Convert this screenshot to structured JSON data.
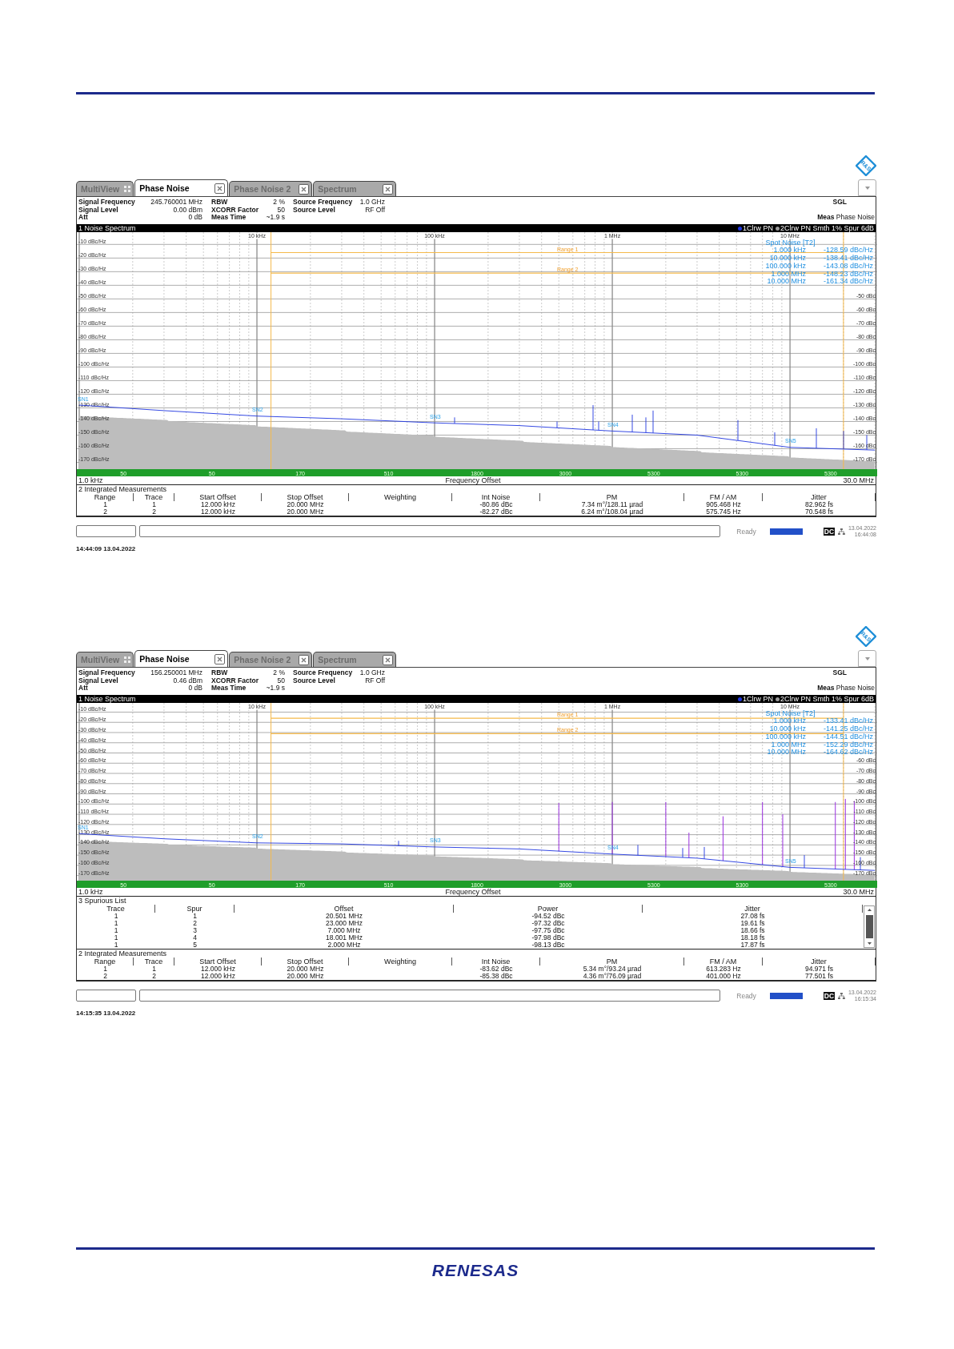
{
  "screens": [
    {
      "logo": "R&S",
      "tabs": [
        {
          "label": "MultiView",
          "selected": false,
          "kind": "multiview"
        },
        {
          "label": "Phase Noise",
          "selected": true,
          "kind": "measurement"
        },
        {
          "label": "Phase Noise 2",
          "selected": false,
          "kind": "measurement"
        },
        {
          "label": "Spectrum",
          "selected": false,
          "kind": "measurement"
        }
      ],
      "info_rows": [
        [
          {
            "label": "Signal Frequency",
            "value": "245.760001 MHz"
          },
          {
            "label": "RBW",
            "value": "2 %"
          },
          {
            "label": "Source Frequency",
            "value": "1.0 GHz"
          }
        ],
        [
          {
            "label": "Signal Level",
            "value": "0.00 dBm"
          },
          {
            "label": "XCORR Factor",
            "value": "50"
          },
          {
            "label": "Source Level",
            "value": "RF Off"
          }
        ],
        [
          {
            "label": "Att",
            "value": "0 dB"
          },
          {
            "label": "Meas Time",
            "value": "~1.9 s"
          }
        ]
      ],
      "sweep_mode": "SGL",
      "meas": "**Meas** Phase Noise",
      "pane_title": "1 Noise Spectrum",
      "other_traces": [
        {
          "label": "2Clrw PN Smth 1% Spur 6dB",
          "color": "#9a9a9a"
        }
      ],
      "x_start": "1.0 kHz",
      "x_stop": "30.0 MHz",
      "chart_data": {
        "type": "line",
        "xlabel": "Frequency Offset",
        "ylim": [
          -175,
          -1
        ],
        "grid": true,
        "categories": [
          null,
          null,
          "10 kHz",
          null,
          "100 kHz",
          null,
          "1 MHz",
          null,
          "10 MHz",
          null
        ],
        "series": [
          {
            "name": "1Clrw PN",
            "color": "#1f35e0",
            "values": [
              -128,
              -132,
              -136,
              -138,
              -141,
              -143,
              -147,
              -150,
              -159,
              -161
            ]
          }
        ],
        "yticks": [
          {
            "value": -10,
            "label": "-10 dBc/Hz"
          },
          {
            "value": -20,
            "label": "-20 dBc/Hz"
          },
          {
            "value": -30,
            "label": "-30 dBc/Hz"
          },
          {
            "value": -40,
            "label": "-40 dBc/Hz"
          },
          {
            "value": -50,
            "label": "-50 dBc/Hz"
          },
          {
            "value": -60,
            "label": "-60 dBc/Hz"
          },
          {
            "value": -70,
            "label": "-70 dBc/Hz"
          },
          {
            "value": -80,
            "label": "-80 dBc/Hz"
          },
          {
            "value": -90,
            "label": "-90 dBc/Hz"
          },
          {
            "value": -100,
            "label": "-100 dBc/Hz"
          },
          {
            "value": -110,
            "label": "-110 dBc/Hz"
          },
          {
            "value": -120,
            "label": "-120 dBc/Hz"
          },
          {
            "value": -130,
            "label": "-130 dBc/Hz"
          },
          {
            "value": -140,
            "label": "-140 dBc/Hz"
          },
          {
            "value": -150,
            "label": "-150 dBc/Hz"
          },
          {
            "value": -160,
            "label": "-160 dBc/Hz"
          },
          {
            "value": -170,
            "label": "-170 dBc/Hz"
          }
        ]
      },
      "ranges": [
        "Range 1",
        "Range 2"
      ],
      "markers": [
        "SN1",
        "SN2",
        "SN3",
        "SN4",
        "SN5"
      ],
      "right_tick_labels": [
        "-50 dBc",
        "-60 dBc",
        "-70 dBc",
        "-80 dBc",
        "-90 dBc",
        "-100 dBc",
        "-110 dBc",
        "-120 dBc",
        "-130 dBc",
        "-140 dBc",
        "-150 dBc",
        "-160 dBc",
        "-170 dBc"
      ],
      "spot_noise": {
        "title": "Spot Noise [T2]",
        "rows": [
          {
            "offset": "1.000 kHz",
            "value": "-128.59 dBc/Hz"
          },
          {
            "offset": "10.000 kHz",
            "value": "-138.41 dBc/Hz"
          },
          {
            "offset": "100.000 kHz",
            "value": "-143.08 dBc/Hz"
          },
          {
            "offset": "1.000 MHz",
            "value": "-148.23 dBc/Hz"
          },
          {
            "offset": "10.000 MHz",
            "value": "-161.34 dBc/Hz"
          }
        ]
      },
      "rbw_labels": [
        "50",
        "50",
        "170",
        "510",
        "1800",
        "3000",
        "5300",
        "5300",
        "5300"
      ],
      "integrated": {
        "title": "2 Integrated Measurements",
        "columns": [
          "Range",
          "Trace",
          "Start Offset",
          "Stop Offset",
          "Weighting",
          "Int Noise",
          "PM",
          "FM / AM",
          "Jitter"
        ],
        "rows": [
          [
            "1",
            "1",
            "12.000 kHz",
            "20.000 MHz",
            "",
            "-80.86 dBc",
            "7.34 m°/128.11 µrad",
            "905.468 Hz",
            "82.962 fs"
          ],
          [
            "2",
            "2",
            "12.000 kHz",
            "20.000 MHz",
            "",
            "-82.27 dBc",
            "6.24 m°/108.04 µrad",
            "575.745 Hz",
            "70.548 fs"
          ]
        ]
      },
      "status": {
        "text": "Ready",
        "badge": "DC",
        "date": "13.04.2022",
        "time": "16:44:08"
      },
      "timestamp": "14:44:09 13.04.2022"
    },
    {
      "logo": "R&S",
      "tabs": [
        {
          "label": "MultiView",
          "selected": false,
          "kind": "multiview"
        },
        {
          "label": "Phase Noise",
          "selected": true,
          "kind": "measurement"
        },
        {
          "label": "Phase Noise 2",
          "selected": false,
          "kind": "measurement"
        },
        {
          "label": "Spectrum",
          "selected": false,
          "kind": "measurement"
        }
      ],
      "info_rows": [
        [
          {
            "label": "Signal Frequency",
            "value": "156.250001 MHz"
          },
          {
            "label": "RBW",
            "value": "2 %"
          },
          {
            "label": "Source Frequency",
            "value": "1.0 GHz"
          }
        ],
        [
          {
            "label": "Signal Level",
            "value": "0.46 dBm"
          },
          {
            "label": "XCORR Factor",
            "value": "50"
          },
          {
            "label": "Source Level",
            "value": "RF Off"
          }
        ],
        [
          {
            "label": "Att",
            "value": "0 dB"
          },
          {
            "label": "Meas Time",
            "value": "~1.9 s"
          }
        ]
      ],
      "sweep_mode": "SGL",
      "meas": "**Meas** Phase Noise",
      "pane_title": "1 Noise Spectrum",
      "other_traces": [
        {
          "label": "2Clrw PN Smth 1% Spur 6dB",
          "color": "#9a9a9a"
        }
      ],
      "x_start": "1.0 kHz",
      "x_stop": "30.0 MHz",
      "chart_data": {
        "type": "line",
        "xlabel": "Frequency Offset",
        "ylim": [
          -175,
          -1
        ],
        "grid": true,
        "categories": [
          null,
          null,
          "10 kHz",
          null,
          "100 kHz",
          null,
          "1 MHz",
          null,
          "10 MHz",
          null
        ],
        "series": [
          {
            "name": "1Clrw PN",
            "color": "#1f35e0",
            "values": [
              -129,
              -134,
              -138,
              -139,
              -142,
              -144,
              -149,
              -153,
              -162,
              -165
            ]
          }
        ],
        "yticks": [
          {
            "value": -10,
            "label": "-10 dBc/Hz"
          },
          {
            "value": -20,
            "label": "-20 dBc/Hz"
          },
          {
            "value": -30,
            "label": "-30 dBc/Hz"
          },
          {
            "value": -40,
            "label": "-40 dBc/Hz"
          },
          {
            "value": -50,
            "label": "-50 dBc/Hz"
          },
          {
            "value": -60,
            "label": "-60 dBc/Hz"
          },
          {
            "value": -70,
            "label": "-70 dBc/Hz"
          },
          {
            "value": -80,
            "label": "-80 dBc/Hz"
          },
          {
            "value": -90,
            "label": "-90 dBc/Hz"
          },
          {
            "value": -100,
            "label": "-100 dBc/Hz"
          },
          {
            "value": -110,
            "label": "-110 dBc/Hz"
          },
          {
            "value": -120,
            "label": "-120 dBc/Hz"
          },
          {
            "value": -130,
            "label": "-130 dBc/Hz"
          },
          {
            "value": -140,
            "label": "-140 dBc/Hz"
          },
          {
            "value": -150,
            "label": "-150 dBc/Hz"
          },
          {
            "value": -160,
            "label": "-160 dBc/Hz"
          },
          {
            "value": -170,
            "label": "-170 dBc/Hz"
          }
        ]
      },
      "ranges": [
        "Range 1",
        "Range 2"
      ],
      "markers": [
        "SN1",
        "SN2",
        "SN3",
        "SN4",
        "SN5"
      ],
      "right_tick_labels": [
        "-60 dBc",
        "-70 dBc",
        "-80 dBc",
        "-90 dBc",
        "-100 dBc",
        "-110 dBc",
        "-120 dBc",
        "-130 dBc",
        "-140 dBc",
        "-150 dBc",
        "-160 dBc",
        "-170 dBc"
      ],
      "spot_noise": {
        "title": "Spot Noise [T2]",
        "rows": [
          {
            "offset": "1.000 kHz",
            "value": "-133.41 dBc/Hz"
          },
          {
            "offset": "10.000 kHz",
            "value": "-141.25 dBc/Hz"
          },
          {
            "offset": "100.000 kHz",
            "value": "-144.51 dBc/Hz"
          },
          {
            "offset": "1.000 MHz",
            "value": "-152.29 dBc/Hz"
          },
          {
            "offset": "10.000 MHz",
            "value": "-164.62 dBc/Hz"
          }
        ]
      },
      "rbw_labels": [
        "50",
        "50",
        "170",
        "510",
        "1800",
        "3000",
        "5300",
        "5300",
        "5300"
      ],
      "spurious_list": {
        "title": "3 Spurious List",
        "columns": [
          "Trace",
          "Spur",
          "Offset",
          "Power",
          "Jitter"
        ],
        "rows": [
          [
            "1",
            "1",
            "20.501 MHz",
            "-94.52 dBc",
            "27.08 fs"
          ],
          [
            "1",
            "2",
            "23.000 MHz",
            "-97.32 dBc",
            "19.61 fs"
          ],
          [
            "1",
            "3",
            "7.000 MHz",
            "-97.75 dBc",
            "18.66 fs"
          ],
          [
            "1",
            "4",
            "18.001 MHz",
            "-97.98 dBc",
            "18.18 fs"
          ],
          [
            "1",
            "5",
            "2.000 MHz",
            "-98.13 dBc",
            "17.87 fs"
          ]
        ]
      },
      "integrated": {
        "title": "2 Integrated Measurements",
        "columns": [
          "Range",
          "Trace",
          "Start Offset",
          "Stop Offset",
          "Weighting",
          "Int Noise",
          "PM",
          "FM / AM",
          "Jitter"
        ],
        "rows": [
          [
            "1",
            "1",
            "12.000 kHz",
            "20.000 MHz",
            "",
            "-83.62 dBc",
            "5.34 m°/93.24 µrad",
            "613.283 Hz",
            "94.971 fs"
          ],
          [
            "2",
            "2",
            "12.000 kHz",
            "20.000 MHz",
            "",
            "-85.38 dBc",
            "4.36 m°/76.09 µrad",
            "401.000 Hz",
            "77.501 fs"
          ]
        ]
      },
      "status": {
        "text": "Ready",
        "badge": "DC",
        "date": "13.04.2022",
        "time": "16:15:34"
      },
      "timestamp": "14:15:35 13.04.2022"
    }
  ],
  "footer": {
    "logo": "RENESAS"
  }
}
